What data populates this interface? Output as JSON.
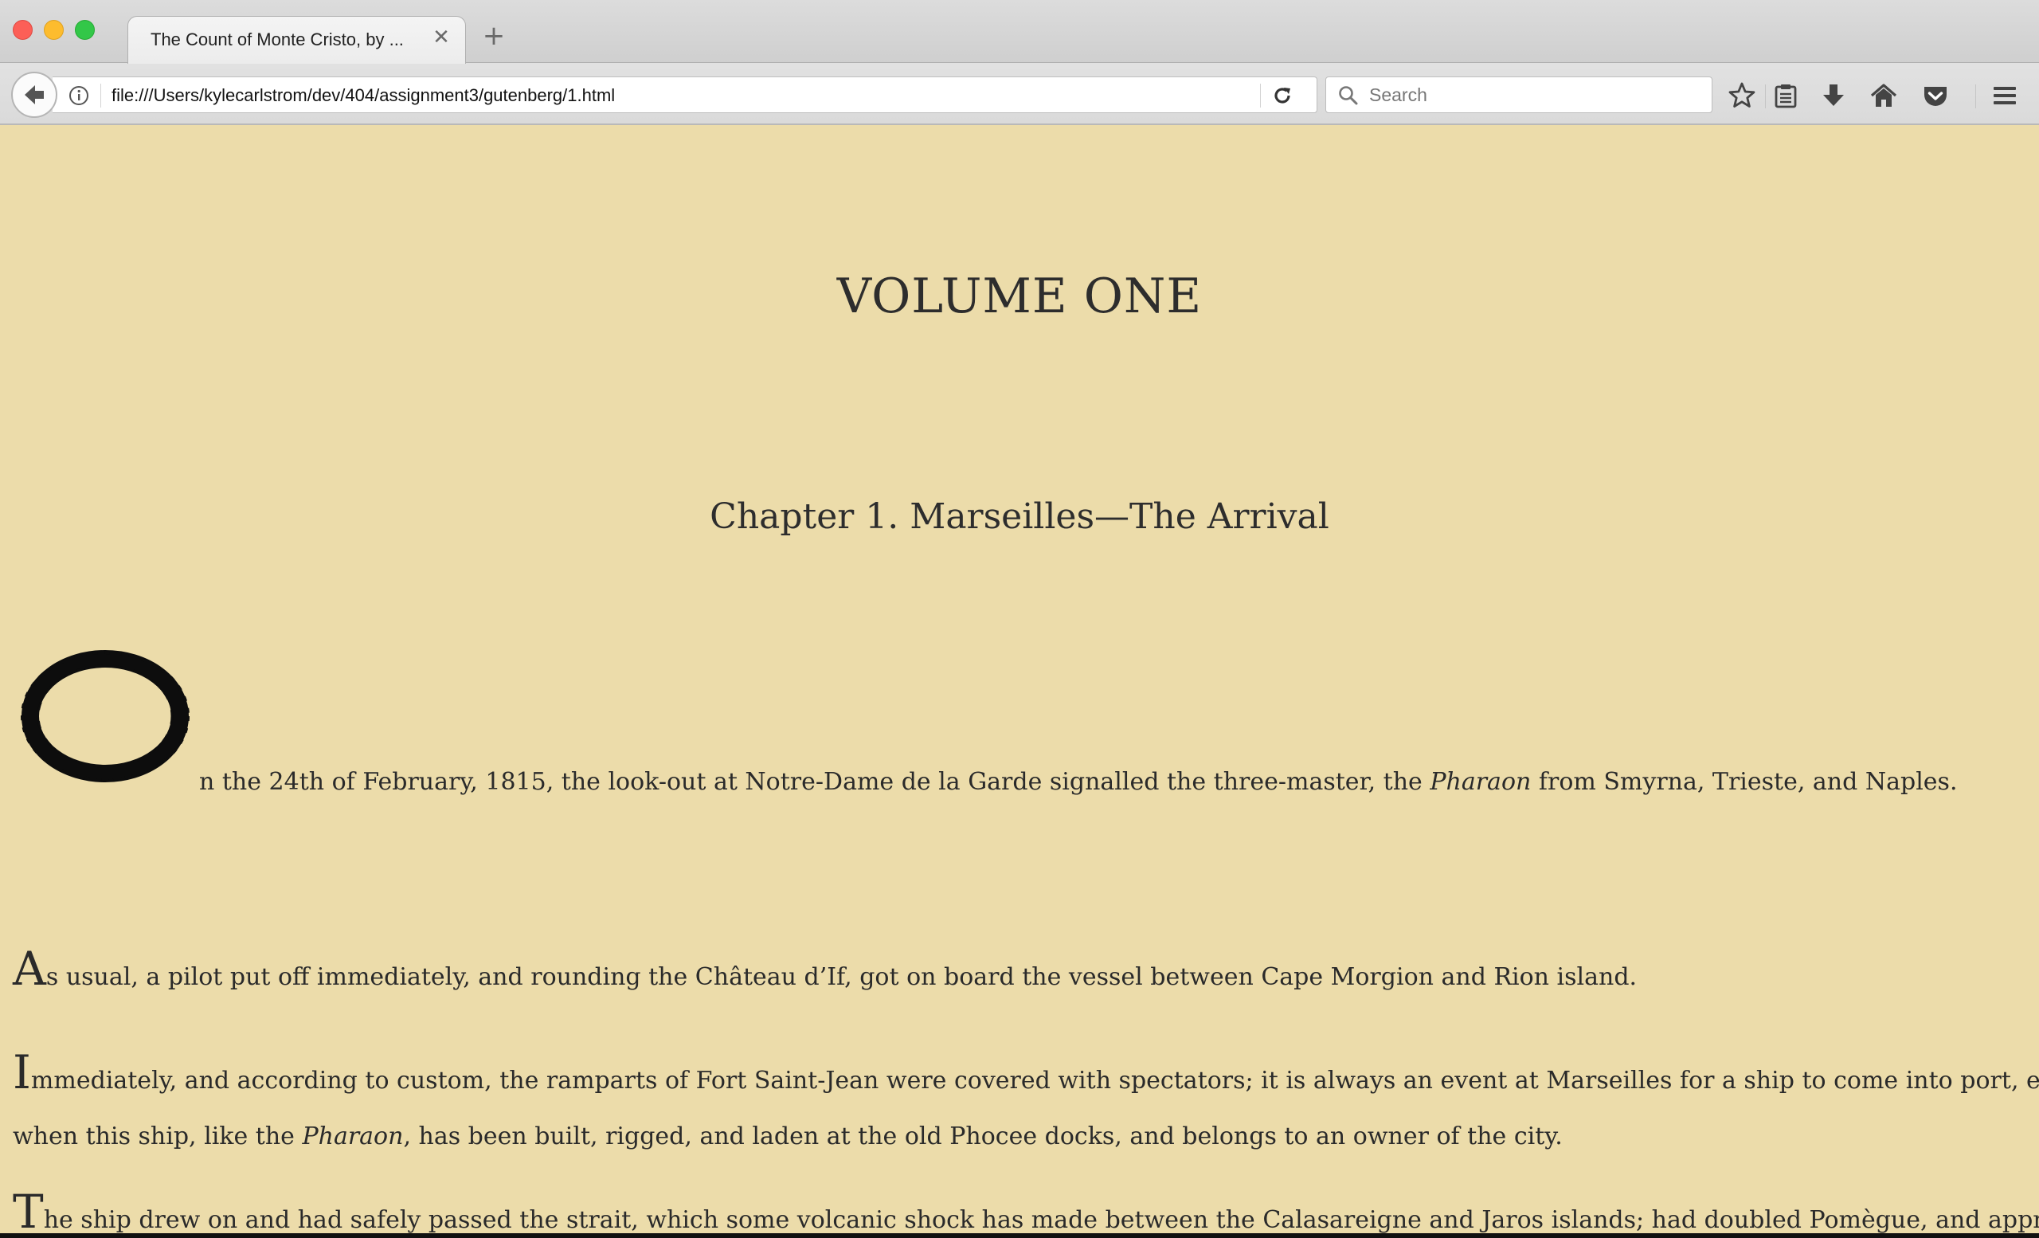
{
  "browser": {
    "tab_title": "The Count of Monte Cristo, by ...",
    "tab_close": "✕",
    "new_tab": "+",
    "url": "file:///Users/kylecarlstrom/dev/404/assignment3/gutenberg/1.html",
    "search_placeholder": "Search"
  },
  "toolbar_icons": [
    "back-arrow-icon",
    "info-icon",
    "reload-icon",
    "search-icon",
    "bookmark-star-icon",
    "reading-list-icon",
    "download-icon",
    "home-icon",
    "pocket-icon",
    "menu-icon"
  ],
  "page": {
    "volume_heading": "VOLUME ONE",
    "chapter_heading": "Chapter 1. Marseilles—The Arrival",
    "paragraph1": {
      "drop_cap": "O",
      "text_before": "n the 24th of February, 1815, the look-out at Notre-Dame de la Garde signalled the three-master, the ",
      "ship_name": "Pharaon",
      "text_after": " from Smyrna, Trieste, and Naples."
    },
    "paragraph2": {
      "initial": "A",
      "text": "s usual, a pilot put off immediately, and rounding the Château d’If, got on board the vessel between Cape Morgion and Rion island."
    },
    "paragraph3": {
      "initial": "I",
      "line1": "mmediately, and according to custom, the ramparts of Fort Saint-Jean were covered with spectators; it is always an event at Marseilles for a ship to come into port, especially",
      "line2_before": "when this ship, like the ",
      "ship_name": "Pharaon",
      "line2_after": ", has been built, rigged, and laden at the old Phocee docks, and belongs to an owner of the city."
    },
    "paragraph4": {
      "initial": "T",
      "text": "he ship drew on and had safely passed the strait, which some volcanic shock has made between the Calasareigne and Jaros islands; had doubled Pomègue, and approached the"
    }
  },
  "colors": {
    "page_background": "#ecdcaa",
    "text": "#2a2a2a",
    "chrome": "#e3e3e3"
  }
}
